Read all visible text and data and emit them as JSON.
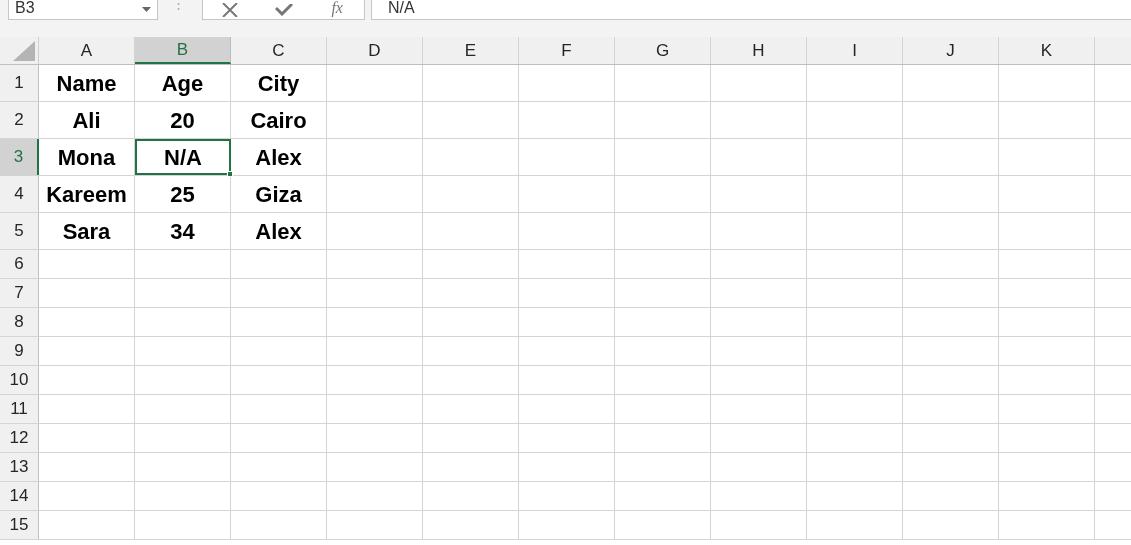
{
  "name_box": {
    "value": "B3"
  },
  "formula_bar": {
    "function_label": "fx",
    "value": "N/A"
  },
  "columns": [
    {
      "label": "A",
      "selected": false
    },
    {
      "label": "B",
      "selected": true
    },
    {
      "label": "C",
      "selected": false
    },
    {
      "label": "D",
      "selected": false
    },
    {
      "label": "E",
      "selected": false
    },
    {
      "label": "F",
      "selected": false
    },
    {
      "label": "G",
      "selected": false
    },
    {
      "label": "H",
      "selected": false
    },
    {
      "label": "I",
      "selected": false
    },
    {
      "label": "J",
      "selected": false
    },
    {
      "label": "K",
      "selected": false
    }
  ],
  "rows": [
    {
      "label": "1",
      "selected": false,
      "cells": [
        {
          "text": "Name",
          "selected": false
        },
        {
          "text": "Age",
          "selected": false
        },
        {
          "text": "City",
          "selected": false
        }
      ]
    },
    {
      "label": "2",
      "selected": false,
      "cells": [
        {
          "text": "Ali",
          "selected": false
        },
        {
          "text": "20",
          "selected": false
        },
        {
          "text": "Cairo",
          "selected": false
        }
      ]
    },
    {
      "label": "3",
      "selected": true,
      "cells": [
        {
          "text": "Mona",
          "selected": false
        },
        {
          "text": "N/A",
          "selected": true
        },
        {
          "text": "Alex",
          "selected": false
        }
      ]
    },
    {
      "label": "4",
      "selected": false,
      "cells": [
        {
          "text": "Kareem",
          "selected": false
        },
        {
          "text": "25",
          "selected": false
        },
        {
          "text": "Giza",
          "selected": false
        }
      ]
    },
    {
      "label": "5",
      "selected": false,
      "cells": [
        {
          "text": "Sara",
          "selected": false
        },
        {
          "text": "34",
          "selected": false
        },
        {
          "text": "Alex",
          "selected": false
        }
      ]
    },
    {
      "label": "6",
      "selected": false
    },
    {
      "label": "7",
      "selected": false
    },
    {
      "label": "8",
      "selected": false
    },
    {
      "label": "9",
      "selected": false
    },
    {
      "label": "10",
      "selected": false
    },
    {
      "label": "11",
      "selected": false
    },
    {
      "label": "12",
      "selected": false
    },
    {
      "label": "13",
      "selected": false
    },
    {
      "label": "14",
      "selected": false
    },
    {
      "label": "15",
      "selected": false
    }
  ]
}
